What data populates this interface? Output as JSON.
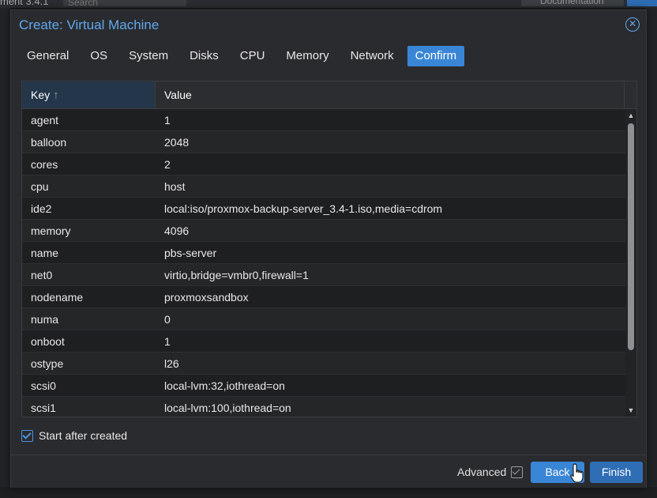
{
  "background": {
    "version_text": "ment 3.4.1",
    "search_placeholder": "Search",
    "docs_label": "Documentation"
  },
  "dialog": {
    "title": "Create: Virtual Machine",
    "tabs": [
      {
        "label": "General"
      },
      {
        "label": "OS"
      },
      {
        "label": "System"
      },
      {
        "label": "Disks"
      },
      {
        "label": "CPU"
      },
      {
        "label": "Memory"
      },
      {
        "label": "Network"
      },
      {
        "label": "Confirm",
        "active": true
      }
    ],
    "grid": {
      "columns": {
        "key": "Key",
        "value": "Value"
      },
      "sort_indicator": "↑",
      "rows": [
        {
          "key": "agent",
          "value": "1"
        },
        {
          "key": "balloon",
          "value": "2048"
        },
        {
          "key": "cores",
          "value": "2"
        },
        {
          "key": "cpu",
          "value": "host"
        },
        {
          "key": "ide2",
          "value": "local:iso/proxmox-backup-server_3.4-1.iso,media=cdrom"
        },
        {
          "key": "memory",
          "value": "4096"
        },
        {
          "key": "name",
          "value": "pbs-server"
        },
        {
          "key": "net0",
          "value": "virtio,bridge=vmbr0,firewall=1"
        },
        {
          "key": "nodename",
          "value": "proxmoxsandbox"
        },
        {
          "key": "numa",
          "value": "0"
        },
        {
          "key": "onboot",
          "value": "1"
        },
        {
          "key": "ostype",
          "value": "l26"
        },
        {
          "key": "scsi0",
          "value": "local-lvm:32,iothread=on"
        },
        {
          "key": "scsi1",
          "value": "local-lvm:100,iothread=on"
        }
      ]
    },
    "start_after_created": {
      "label": "Start after created",
      "checked": true
    },
    "footer": {
      "advanced_label": "Advanced",
      "advanced_checked": true,
      "back_label": "Back",
      "finish_label": "Finish"
    }
  },
  "colors": {
    "accent": "#3a86d6",
    "title": "#61a8ee",
    "dialog_bg": "#2a2b2e"
  }
}
